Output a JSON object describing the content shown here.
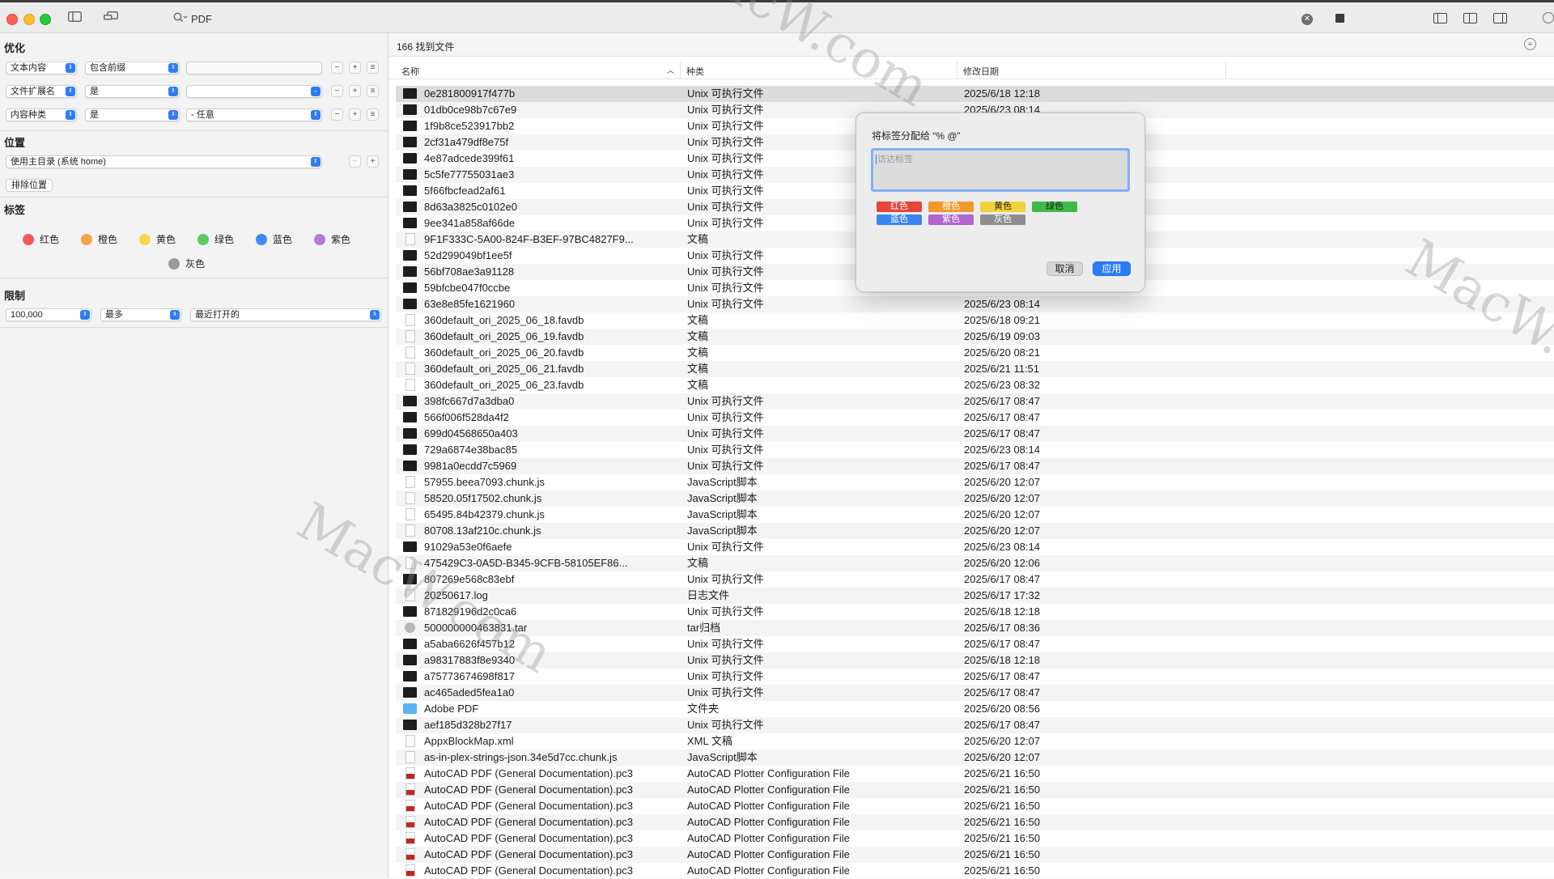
{
  "toolbar": {
    "search_query": "PDF"
  },
  "sidebar": {
    "optimize": {
      "title": "优化",
      "rows": [
        {
          "attr": "文本内容",
          "op": "包含前缀",
          "value": ""
        },
        {
          "attr": "文件扩展名",
          "op": "是",
          "value": ""
        },
        {
          "attr": "内容种类",
          "op": "是",
          "value": "- 任意"
        }
      ]
    },
    "location": {
      "title": "位置",
      "select": "使用主目录 (系统 home)",
      "exclude_button": "排除位置"
    },
    "tags": {
      "title": "标签",
      "items": [
        {
          "label": "红色",
          "color": "#f05a5a"
        },
        {
          "label": "橙色",
          "color": "#f6a14a"
        },
        {
          "label": "黄色",
          "color": "#f8d64e"
        },
        {
          "label": "绿色",
          "color": "#5ccb5f"
        },
        {
          "label": "蓝色",
          "color": "#3d8af7"
        },
        {
          "label": "紫色",
          "color": "#b77ad8"
        },
        {
          "label": "灰色",
          "color": "#9a9a9a"
        }
      ]
    },
    "limit": {
      "title": "限制",
      "count": "100,000",
      "mode": "最多",
      "order": "最近打开的"
    }
  },
  "results": {
    "count_text": "166 找到文件",
    "columns": {
      "name": "名称",
      "kind": "种类",
      "date": "修改日期"
    },
    "rows": [
      {
        "name": "0e281800917f477b",
        "kind": "Unix 可执行文件",
        "date": "2025/6/18 12:18",
        "icon": "exec"
      },
      {
        "name": "01db0ce98b7c67e9",
        "kind": "Unix 可执行文件",
        "date": "2025/6/23 08:14",
        "icon": "exec"
      },
      {
        "name": "1f9b8ce523917bb2",
        "kind": "Unix 可执行文件",
        "date": "",
        "icon": "exec"
      },
      {
        "name": "2cf31a479df8e75f",
        "kind": "Unix 可执行文件",
        "date": "",
        "icon": "exec"
      },
      {
        "name": "4e87adcede399f61",
        "kind": "Unix 可执行文件",
        "date": "",
        "icon": "exec"
      },
      {
        "name": "5c5fe77755031ae3",
        "kind": "Unix 可执行文件",
        "date": "",
        "icon": "exec"
      },
      {
        "name": "5f66fbcfead2af61",
        "kind": "Unix 可执行文件",
        "date": "",
        "icon": "exec"
      },
      {
        "name": "8d63a3825c0102e0",
        "kind": "Unix 可执行文件",
        "date": "",
        "icon": "exec"
      },
      {
        "name": "9ee341a858af66de",
        "kind": "Unix 可执行文件",
        "date": "",
        "icon": "exec"
      },
      {
        "name": "9F1F333C-5A00-824F-B3EF-97BC4827F9...",
        "kind": "文稿",
        "date": "",
        "icon": "doc"
      },
      {
        "name": "52d299049bf1ee5f",
        "kind": "Unix 可执行文件",
        "date": "",
        "icon": "exec"
      },
      {
        "name": "56bf708ae3a91128",
        "kind": "Unix 可执行文件",
        "date": "",
        "icon": "exec"
      },
      {
        "name": "59bfcbe047f0ccbe",
        "kind": "Unix 可执行文件",
        "date": "",
        "icon": "exec"
      },
      {
        "name": "63e8e85fe1621960",
        "kind": "Unix 可执行文件",
        "date": "2025/6/23 08:14",
        "icon": "exec"
      },
      {
        "name": "360default_ori_2025_06_18.favdb",
        "kind": "文稿",
        "date": "2025/6/18 09:21",
        "icon": "doc"
      },
      {
        "name": "360default_ori_2025_06_19.favdb",
        "kind": "文稿",
        "date": "2025/6/19 09:03",
        "icon": "doc"
      },
      {
        "name": "360default_ori_2025_06_20.favdb",
        "kind": "文稿",
        "date": "2025/6/20 08:21",
        "icon": "doc"
      },
      {
        "name": "360default_ori_2025_06_21.favdb",
        "kind": "文稿",
        "date": "2025/6/21 11:51",
        "icon": "doc"
      },
      {
        "name": "360default_ori_2025_06_23.favdb",
        "kind": "文稿",
        "date": "2025/6/23 08:32",
        "icon": "doc"
      },
      {
        "name": "398fc667d7a3dba0",
        "kind": "Unix 可执行文件",
        "date": "2025/6/17 08:47",
        "icon": "exec"
      },
      {
        "name": "566f006f528da4f2",
        "kind": "Unix 可执行文件",
        "date": "2025/6/17 08:47",
        "icon": "exec"
      },
      {
        "name": "699d04568650a403",
        "kind": "Unix 可执行文件",
        "date": "2025/6/17 08:47",
        "icon": "exec"
      },
      {
        "name": "729a6874e38bac85",
        "kind": "Unix 可执行文件",
        "date": "2025/6/23 08:14",
        "icon": "exec"
      },
      {
        "name": "9981a0ecdd7c5969",
        "kind": "Unix 可执行文件",
        "date": "2025/6/17 08:47",
        "icon": "exec"
      },
      {
        "name": "57955.beea7093.chunk.js",
        "kind": "JavaScript脚本",
        "date": "2025/6/20 12:07",
        "icon": "doc"
      },
      {
        "name": "58520.05f17502.chunk.js",
        "kind": "JavaScript脚本",
        "date": "2025/6/20 12:07",
        "icon": "doc"
      },
      {
        "name": "65495.84b42379.chunk.js",
        "kind": "JavaScript脚本",
        "date": "2025/6/20 12:07",
        "icon": "doc"
      },
      {
        "name": "80708.13af210c.chunk.js",
        "kind": "JavaScript脚本",
        "date": "2025/6/20 12:07",
        "icon": "doc"
      },
      {
        "name": "91029a53e0f6aefe",
        "kind": "Unix 可执行文件",
        "date": "2025/6/23 08:14",
        "icon": "exec"
      },
      {
        "name": "475429C3-0A5D-B345-9CFB-58105EF86...",
        "kind": "文稿",
        "date": "2025/6/20 12:06",
        "icon": "doc"
      },
      {
        "name": "807269e568c83ebf",
        "kind": "Unix 可执行文件",
        "date": "2025/6/17 08:47",
        "icon": "exec"
      },
      {
        "name": "20250617.log",
        "kind": "日志文件",
        "date": "2025/6/17 17:32",
        "icon": "doc"
      },
      {
        "name": "871829196d2c0ca6",
        "kind": "Unix 可执行文件",
        "date": "2025/6/18 12:18",
        "icon": "exec"
      },
      {
        "name": "500000000463831.tar",
        "kind": "tar归档",
        "date": "2025/6/17 08:36",
        "icon": "tar"
      },
      {
        "name": "a5aba6626f457b12",
        "kind": "Unix 可执行文件",
        "date": "2025/6/17 08:47",
        "icon": "exec"
      },
      {
        "name": "a98317883f8e9340",
        "kind": "Unix 可执行文件",
        "date": "2025/6/18 12:18",
        "icon": "exec"
      },
      {
        "name": "a75773674698f817",
        "kind": "Unix 可执行文件",
        "date": "2025/6/17 08:47",
        "icon": "exec"
      },
      {
        "name": "ac465aded5fea1a0",
        "kind": "Unix 可执行文件",
        "date": "2025/6/17 08:47",
        "icon": "exec"
      },
      {
        "name": "Adobe PDF",
        "kind": "文件夹",
        "date": "2025/6/20 08:56",
        "icon": "folder"
      },
      {
        "name": "aef185d328b27f17",
        "kind": "Unix 可执行文件",
        "date": "2025/6/17 08:47",
        "icon": "exec"
      },
      {
        "name": "AppxBlockMap.xml",
        "kind": "XML 文稿",
        "date": "2025/6/20 12:07",
        "icon": "doc"
      },
      {
        "name": "as-in-plex-strings-json.34e5d7cc.chunk.js",
        "kind": "JavaScript脚本",
        "date": "2025/6/20 12:07",
        "icon": "doc"
      },
      {
        "name": "AutoCAD PDF (General Documentation).pc3",
        "kind": "AutoCAD Plotter Configuration File",
        "date": "2025/6/21 16:50",
        "icon": "pc3"
      },
      {
        "name": "AutoCAD PDF (General Documentation).pc3",
        "kind": "AutoCAD Plotter Configuration File",
        "date": "2025/6/21 16:50",
        "icon": "pc3"
      },
      {
        "name": "AutoCAD PDF (General Documentation).pc3",
        "kind": "AutoCAD Plotter Configuration File",
        "date": "2025/6/21 16:50",
        "icon": "pc3"
      },
      {
        "name": "AutoCAD PDF (General Documentation).pc3",
        "kind": "AutoCAD Plotter Configuration File",
        "date": "2025/6/21 16:50",
        "icon": "pc3"
      },
      {
        "name": "AutoCAD PDF (General Documentation).pc3",
        "kind": "AutoCAD Plotter Configuration File",
        "date": "2025/6/21 16:50",
        "icon": "pc3"
      },
      {
        "name": "AutoCAD PDF (General Documentation).pc3",
        "kind": "AutoCAD Plotter Configuration File",
        "date": "2025/6/21 16:50",
        "icon": "pc3"
      },
      {
        "name": "AutoCAD PDF (General Documentation).pc3",
        "kind": "AutoCAD Plotter Configuration File",
        "date": "2025/6/21 16:50",
        "icon": "pc3"
      }
    ]
  },
  "dialog": {
    "title": "将标签分配给 “% @”",
    "placeholder": "访达标签",
    "tags": [
      {
        "label": "红色",
        "color": "#e5453c"
      },
      {
        "label": "橙色",
        "color": "#f0982e"
      },
      {
        "label": "黄色",
        "color": "#f3d13a"
      },
      {
        "label": "绿色",
        "color": "#3fb94a"
      },
      {
        "label": "蓝色",
        "color": "#3a86f0"
      },
      {
        "label": "紫色",
        "color": "#b065d0"
      },
      {
        "label": "灰色",
        "color": "#8e8e8e"
      }
    ],
    "cancel": "取消",
    "apply": "应用"
  },
  "watermark": "MacW.com"
}
